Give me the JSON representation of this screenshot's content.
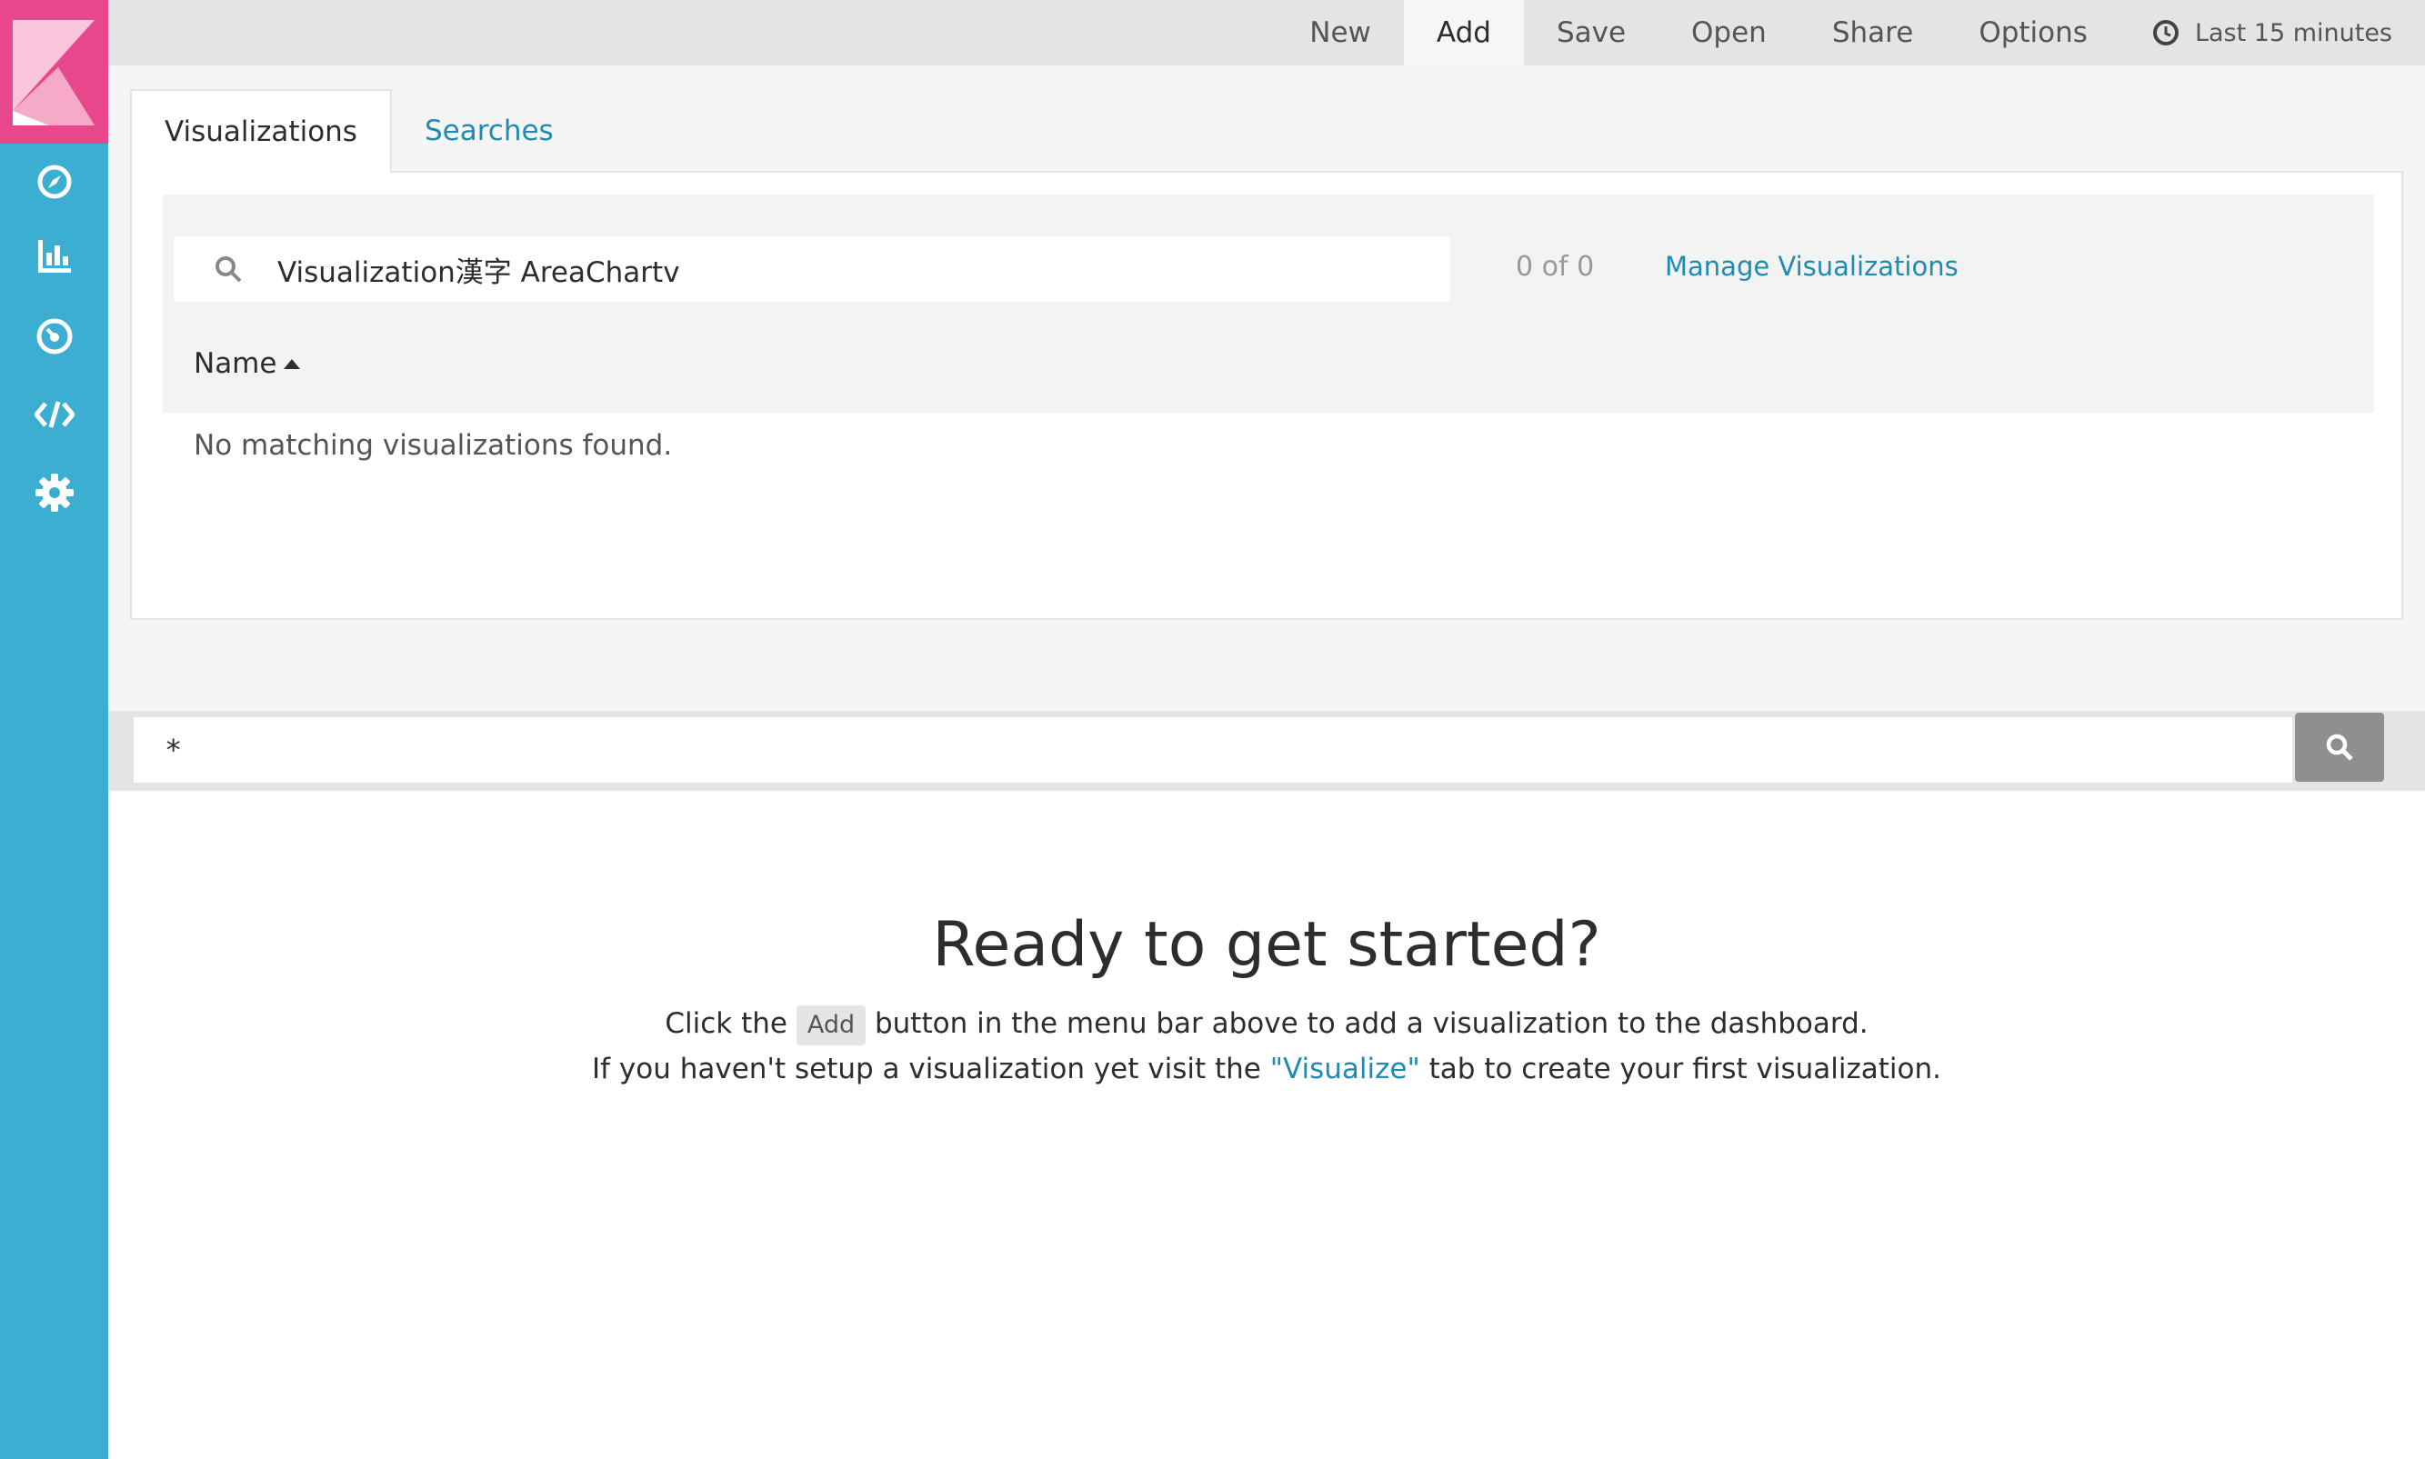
{
  "nav": {
    "items": [
      {
        "name": "compass-icon"
      },
      {
        "name": "bar-chart-icon"
      },
      {
        "name": "gauge-icon"
      },
      {
        "name": "code-icon"
      },
      {
        "name": "gear-icon"
      }
    ]
  },
  "menu": {
    "new": "New",
    "add": "Add",
    "save": "Save",
    "open": "Open",
    "share": "Share",
    "options": "Options",
    "time": "Last 15 minutes"
  },
  "tabs": {
    "visualizations": "Visualizations",
    "searches": "Searches"
  },
  "finder": {
    "search_value": "Visualization漢字 AreaChartv",
    "count": "0 of 0",
    "manage_link": "Manage Visualizations",
    "column_name": "Name",
    "empty_message": "No matching visualizations found."
  },
  "query": {
    "value": "*"
  },
  "empty_state": {
    "title": "Ready to get started?",
    "line1_before": "Click the",
    "line1_kbd": "Add",
    "line1_after": "button in the menu bar above to add a visualization to the dashboard.",
    "line2_before": "If you haven't setup a visualization yet visit the",
    "line2_link": "\"Visualize\"",
    "line2_after": "tab to create your first visualization."
  },
  "colors": {
    "sidebar": "#3caed2",
    "logo_bg": "#e8488b",
    "link": "#1f8bb0"
  }
}
